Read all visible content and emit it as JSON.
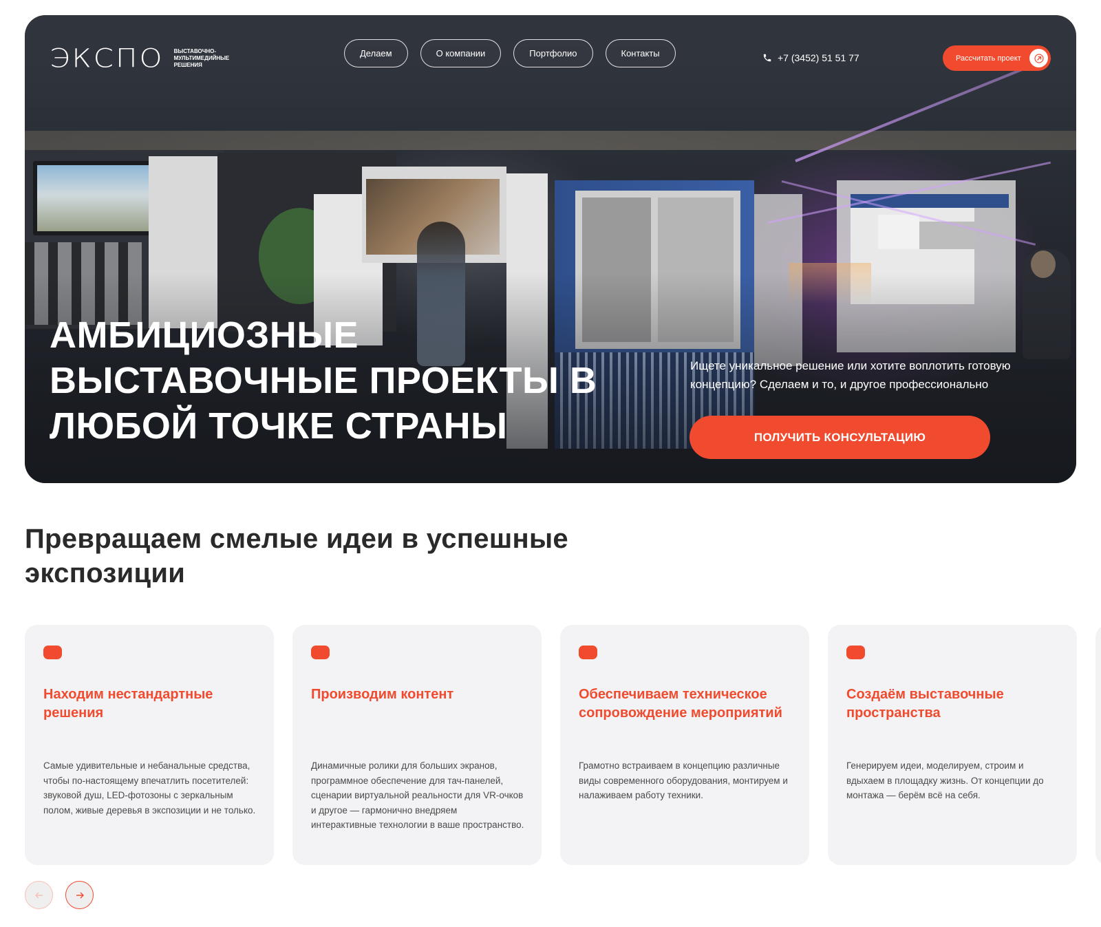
{
  "brand": {
    "logo_text": "ЭКСПО",
    "logo_subtitle": "ВЫСТАВОЧНО-МУЛЬТИМЕДИЙНЫЕ РЕШЕНИЯ"
  },
  "nav": {
    "items": [
      {
        "label": "Делаем"
      },
      {
        "label": "О компании"
      },
      {
        "label": "Портфолио"
      },
      {
        "label": "Контакты"
      }
    ]
  },
  "header": {
    "phone": "+7 (3452) 51 51 77",
    "cta_label": "Рассчитать проект"
  },
  "hero": {
    "title": "АМБИЦИОЗНЫЕ ВЫСТАВОЧНЫЕ ПРОЕКТЫ В ЛЮБОЙ ТОЧКЕ СТРАНЫ",
    "description": "Ищете уникальное решение или хотите воплотить готовую концепцию? Сделаем и то, и другое профессионально",
    "cta_label": "ПОЛУЧИТЬ КОНСУЛЬТАЦИЮ"
  },
  "services": {
    "title": "Превращаем смелые идеи в успешные экспозиции",
    "cards": [
      {
        "title": "Находим нестандартные решения",
        "text": "Самые удивительные и небанальные средства, чтобы по-настоящему впечатлить посетителей: звуковой душ, LED-фотозоны с зеркальным полом, живые деревья в экспозиции и не только."
      },
      {
        "title": "Производим контент",
        "text": "Динамичные ролики для больших экранов, программное обеспечение для тач-панелей, сценарии виртуальной реальности для VR-очков и другое — гармонично внедряем интерактивные технологии в ваше пространство."
      },
      {
        "title": "Обеспечиваем техническое сопровождение мероприятий",
        "text": "Грамотно встраиваем в концепцию различные виды современного оборудования, монтируем и налаживаем работу техники."
      },
      {
        "title": "Создаём выставочные пространства",
        "text": "Генерируем идеи, моделируем, строим и вдыхаем в площадку жизнь. От концепции до монтажа — берём всё на себя."
      }
    ]
  },
  "colors": {
    "accent": "#f04b2e",
    "hero_bg": "#24272e",
    "card_bg": "#f3f3f5"
  },
  "icons": {
    "phone": "phone-icon",
    "cta_arrow": "arrow-up-right-icon",
    "prev": "arrow-left-icon",
    "next": "arrow-right-icon"
  }
}
